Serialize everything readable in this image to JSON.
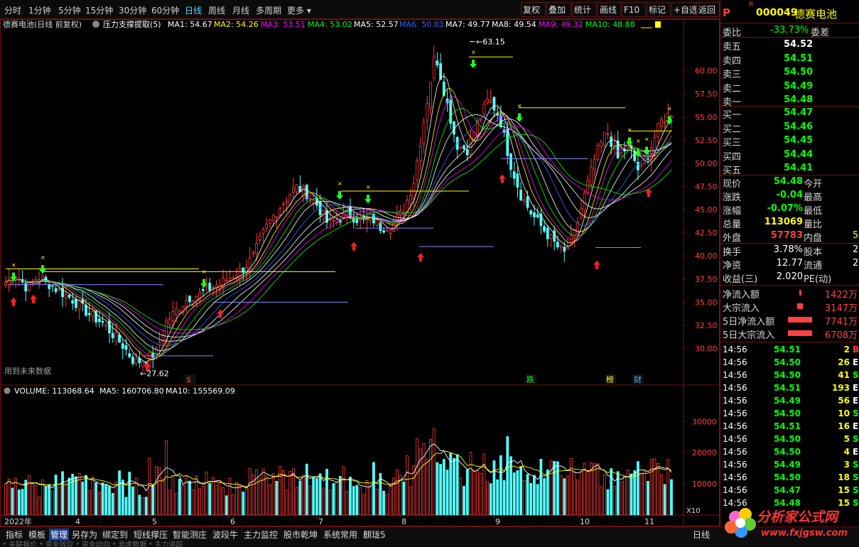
{
  "toolbar": {
    "periods": [
      "分时",
      "1分钟",
      "5分钟",
      "15分钟",
      "30分钟",
      "60分钟",
      "日线",
      "周线",
      "月线",
      "多周期",
      "更多"
    ],
    "selected_period": "日线",
    "right_buttons": [
      "复权",
      "叠加",
      "统计",
      "画线",
      "F10",
      "标记",
      "+自选",
      "返回"
    ]
  },
  "stock": {
    "code": "000049",
    "name": "德赛电池",
    "p_badge": "P",
    "r_badge": "R"
  },
  "chart_header": {
    "title": "德赛电池(日线 前复权)",
    "indicator": "压力支撑提取(5)",
    "ma_labels": [
      {
        "label": "MA1: 54.67",
        "color": "#ffffff"
      },
      {
        "label": "MA2: 54.26",
        "color": "#ffff00"
      },
      {
        "label": "MA3: 53.51",
        "color": "#ff00ff"
      },
      {
        "label": "MA4: 53.02",
        "color": "#00ff00"
      },
      {
        "label": "MA5: 52.57",
        "color": "#ffffff"
      },
      {
        "label": "MA6: 50.03",
        "color": "#3366ff"
      },
      {
        "label": "MA7: 49.77",
        "color": "#ffffff"
      },
      {
        "label": "MA8: 49.54",
        "color": "#ffffff"
      },
      {
        "label": "MA9: 49.32",
        "color": "#ff00ff"
      },
      {
        "label": "MA10: 48.88",
        "color": "#00ff00"
      }
    ],
    "future_note": "用到未来数据",
    "high_label": "63.15",
    "low_label": "27.62",
    "event_labels": [
      {
        "text": "$",
        "color": "#ff3030"
      },
      {
        "text": "跌",
        "color": "#00ff00"
      },
      {
        "text": "榜",
        "color": "#ffff00"
      },
      {
        "text": "财",
        "color": "#55aaff"
      }
    ]
  },
  "volume_header": {
    "label": "VOLUME: 113068.64",
    "ma5": "MA5: 160706.80",
    "ma10": "MA10: 155569.09",
    "unit": "X10"
  },
  "chart_data": [
    {
      "type": "candlestick",
      "title": "德赛电池(日线 前复权)",
      "y_ticks": [
        "60.00",
        "57.50",
        "55.00",
        "52.50",
        "50.00",
        "47.50",
        "45.00",
        "42.50",
        "40.00",
        "37.50",
        "35.00",
        "32.50",
        "30.00"
      ],
      "ylim": [
        27.62,
        63.15
      ],
      "x_months": [
        "2022年",
        "4",
        "5",
        "6",
        "7",
        "8",
        "9",
        "10",
        "11"
      ],
      "close_path": [
        37.2,
        38.0,
        36.5,
        37.8,
        37.0,
        36.2,
        35.5,
        34.5,
        33.5,
        32.8,
        31.5,
        30.2,
        28.5,
        28.8,
        29.5,
        33.0,
        34.2,
        35.5,
        35.8,
        36.5,
        37.0,
        37.8,
        38.5,
        39.8,
        42.5,
        44.5,
        46.0,
        47.5,
        46.8,
        45.5,
        43.5,
        44.0,
        44.5,
        43.8,
        44.2,
        43.0,
        43.5,
        44.8,
        48.0,
        55.0,
        62.0,
        57.0,
        52.0,
        51.5,
        54.5,
        57.0,
        55.0,
        50.0,
        46.5,
        44.5,
        43.0,
        41.5,
        40.2,
        42.5,
        47.0,
        51.0,
        53.5,
        50.5,
        52.0,
        49.0,
        51.5,
        54.5,
        55.5
      ],
      "high": 63.15,
      "low": 27.62
    },
    {
      "type": "bar",
      "title": "VOLUME",
      "y_ticks": [
        "30000",
        "20000",
        "10000"
      ],
      "ylim": [
        0,
        36000
      ],
      "volume": 113068.64,
      "ma5": 160706.8,
      "ma10": 155569.09
    }
  ],
  "quote": {
    "weibi_label": "委比",
    "weibi": "-33.73%",
    "weicha_label": "委差",
    "sell": [
      {
        "label": "卖五",
        "price": "54.52"
      },
      {
        "label": "卖四",
        "price": "54.51"
      },
      {
        "label": "卖三",
        "price": "54.50"
      },
      {
        "label": "卖二",
        "price": "54.49"
      },
      {
        "label": "卖一",
        "price": "54.48"
      }
    ],
    "buy": [
      {
        "label": "买一",
        "price": "54.47"
      },
      {
        "label": "买二",
        "price": "54.46"
      },
      {
        "label": "买三",
        "price": "54.45"
      },
      {
        "label": "买四",
        "price": "54.44"
      },
      {
        "label": "买五",
        "price": "54.41"
      }
    ],
    "stats": [
      {
        "label": "现价",
        "value": "54.48",
        "label2": "今开"
      },
      {
        "label": "涨跌",
        "value": "-0.04",
        "label2": "最高"
      },
      {
        "label": "涨幅",
        "value": "-0.07%",
        "label2": "最低"
      },
      {
        "label": "总量",
        "value": "113069",
        "label2": "量比"
      },
      {
        "label": "外盘",
        "value": "57783",
        "label2": "内盘",
        "tail": "5"
      }
    ],
    "stats2": [
      {
        "label": "换手",
        "value": "3.78%",
        "label2": "股本",
        "tail": "2"
      },
      {
        "label": "净资",
        "value": "12.77",
        "label2": "流通",
        "tail": "2"
      },
      {
        "label": "收益(三)",
        "value": "2.020",
        "label2": "PE(动)"
      }
    ],
    "flows": [
      {
        "label": "净流入额",
        "value": "1422万"
      },
      {
        "label": "大宗流入",
        "value": "3147万"
      },
      {
        "label": "5日净流入额",
        "value": "7741万"
      },
      {
        "label": "5日大宗流入",
        "value": "6708万"
      }
    ]
  },
  "ticks": [
    {
      "time": "14:56",
      "price": "54.51",
      "vol": "2",
      "side": "B"
    },
    {
      "time": "14:56",
      "price": "54.50",
      "vol": "26",
      "side": "E"
    },
    {
      "time": "14:56",
      "price": "54.50",
      "vol": "41",
      "side": "S"
    },
    {
      "time": "14:56",
      "price": "54.51",
      "vol": "193",
      "side": "E"
    },
    {
      "time": "14:56",
      "price": "54.49",
      "vol": "56",
      "side": "E"
    },
    {
      "time": "14:56",
      "price": "54.50",
      "vol": "10",
      "side": "S"
    },
    {
      "time": "14:56",
      "price": "54.51",
      "vol": "16",
      "side": "E"
    },
    {
      "time": "14:56",
      "price": "54.50",
      "vol": "5",
      "side": "S"
    },
    {
      "time": "14:56",
      "price": "54.50",
      "vol": "4",
      "side": "E"
    },
    {
      "time": "14:56",
      "price": "54.49",
      "vol": "3",
      "side": "S"
    },
    {
      "time": "14:56",
      "price": "54.50",
      "vol": "18",
      "side": "S"
    },
    {
      "time": "14:56",
      "price": "54.47",
      "vol": "15",
      "side": "S"
    },
    {
      "time": "14:56",
      "price": "54.48",
      "vol": "15",
      "side": "S"
    }
  ],
  "bottom_tabs": [
    "指标",
    "模板",
    "管理",
    "另存为",
    "绑定到",
    "短线撑压",
    "智能测庄",
    "波段牛",
    "主力监控",
    "股市乾坤",
    "系统常用",
    "麒珑5"
  ],
  "selected_tab": "管理",
  "bottom_right": "日线",
  "bottom_tail": "* 关联报价 * 资金效应 * 资金动向 * 龙虎数据 * 主力追踪",
  "watermark": {
    "title": "分析家公式网",
    "url": "www.fxjgsw.com"
  },
  "colors": {
    "up": "#ff3b3b",
    "down": "#54ffff",
    "frame": "#7a1010",
    "yellow": "#ffff00",
    "green": "#00ff00"
  }
}
